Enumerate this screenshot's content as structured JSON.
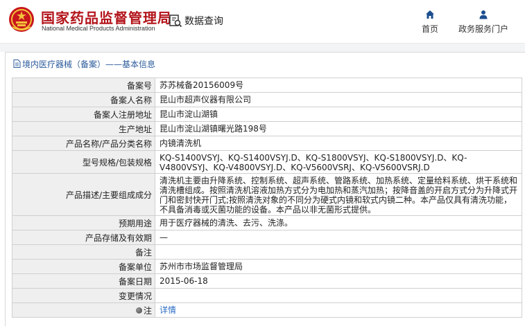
{
  "header": {
    "org_name_cn": "国家药品监督管理局",
    "org_name_en": "National Medical Products Administration",
    "query_label": "数据查询",
    "nav": [
      {
        "label": "首页",
        "icon": "home-icon"
      },
      {
        "label": "政务服务门户",
        "icon": "user-icon"
      }
    ]
  },
  "breadcrumb": "境内医疗器械（备案）——基本信息",
  "colors": {
    "brand_red": "#b3141b",
    "link_blue": "#2b6cc4",
    "label_bg": "#efefef"
  },
  "rows": [
    {
      "label": "备案号",
      "value": "苏苏械备20156009号"
    },
    {
      "label": "备案人名称",
      "value": "昆山市超声仪器有限公司"
    },
    {
      "label": "备案人注册地址",
      "value": "昆山市淀山湖镇"
    },
    {
      "label": "生产地址",
      "value": "昆山市淀山湖镇曙光路198号"
    },
    {
      "label": "产品名称/产品分类名称",
      "value": "内镜清洗机"
    },
    {
      "label": "型号规格/包装规格",
      "value": "KQ-S1400VSYJ、KQ-S1400VSYJ.D、KQ-S1800VSYJ、KQ-S1800VSYJ.D、KQ-V4800VSYJ、KQ-V4800VSYJ.D、KQ-V5600VSRJ、KQ-V5600VSRJ.D"
    },
    {
      "label": "产品描述/主要组成成分",
      "value": "清洗机主要由升降系统、控制系统、超声系统、管路系统、加热系统、定量给料系统、烘干系统和清洗槽组成。按照清洗机溶液加热方式分为电加热和蒸汽加热；按降音盖的开启方式分为升降式开门和密封快开门式;按照清洗对象的不同分为硬式内镜和软式内镜二种。本产品仅具有清洗功能，不具备消毒或灭菌功能的设备。本产品以非无菌形式提供。"
    },
    {
      "label": "预期用途",
      "value": "用于医疗器械的清洗、去污、洗涤。"
    },
    {
      "label": "产品存储及有效期",
      "value": "—"
    },
    {
      "label": "备注",
      "value": ""
    },
    {
      "label": "备案单位",
      "value": "苏州市市场监督管理局"
    },
    {
      "label": "备案日期",
      "value": "2015-06-18"
    },
    {
      "label": "变更情况",
      "value": ""
    },
    {
      "label": "注",
      "value": "详情"
    }
  ]
}
